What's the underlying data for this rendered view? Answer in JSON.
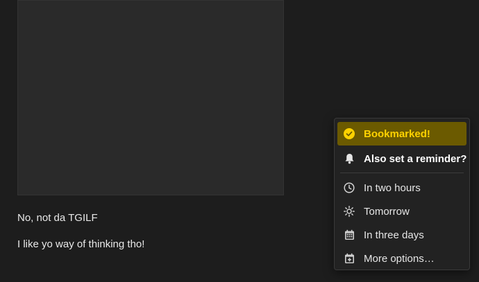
{
  "post": {
    "paragraphs": [
      "No, not da TGILF",
      "I like yo way of thinking tho!"
    ]
  },
  "bookmark_menu": {
    "bookmarked_label": "Bookmarked!",
    "reminder_heading": "Also set a reminder?",
    "options": [
      {
        "label": "In two hours",
        "icon": "clock-icon"
      },
      {
        "label": "Tomorrow",
        "icon": "sun-icon"
      },
      {
        "label": "In three days",
        "icon": "calendar-icon"
      },
      {
        "label": "More options…",
        "icon": "calendar-plus-icon"
      }
    ]
  },
  "colors": {
    "accent": "#ffd200",
    "bookmarked_bg": "#6b5a00",
    "page_bg": "#1d1d1d",
    "menu_bg": "#222222"
  }
}
